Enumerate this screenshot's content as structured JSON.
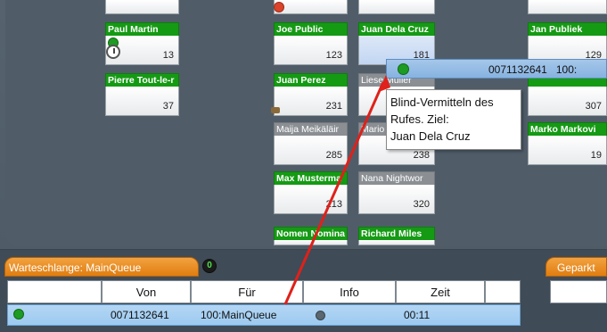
{
  "extensions": [
    {
      "name": "Paul Martin",
      "number": "13",
      "state": "green",
      "icon": "clock-icon"
    },
    {
      "name": "Pierre Tout-le-r",
      "number": "37",
      "state": "green"
    },
    {
      "name": "Joe Public",
      "number": "123",
      "state": "green"
    },
    {
      "name": "Juan Perez",
      "number": "231",
      "state": "green"
    },
    {
      "name": "Maija Meikäläir",
      "number": "285",
      "state": "gray"
    },
    {
      "name": "Max Musterma",
      "number": "213",
      "state": "green"
    },
    {
      "name": "Nomen Nomina",
      "number": "",
      "state": "green"
    },
    {
      "name": "Juan Dela Cruz",
      "number": "181",
      "state": "green"
    },
    {
      "name": "Liese Müller",
      "number": "",
      "state": "gray"
    },
    {
      "name": "Mario",
      "number": "238",
      "state": "gray"
    },
    {
      "name": "Nana Nightwor",
      "number": "320",
      "state": "gray"
    },
    {
      "name": "Richard Miles",
      "number": "",
      "state": "green"
    },
    {
      "name": "Jan Publiek",
      "number": "129",
      "state": "green"
    },
    {
      "name": "",
      "number": "307",
      "state": "green"
    },
    {
      "name": "Marko Markovi",
      "number": "19",
      "state": "green"
    }
  ],
  "drag": {
    "number": "0071132641",
    "target_short": "100:",
    "tooltip_line1": "Blind-Vermitteln des",
    "tooltip_line2": "Rufes. Ziel:",
    "tooltip_line3": "Juan Dela Cruz"
  },
  "queue": {
    "tab_label": "Warteschlange: MainQueue",
    "count": "0",
    "parked_label": "Geparkt",
    "columns": [
      "",
      "Von",
      "Für",
      "Info",
      "Zeit",
      ""
    ],
    "row": {
      "von": "0071132641",
      "fuer": "100:MainQueue",
      "zeit": "00:11"
    }
  },
  "colors": {
    "green": "#159a14",
    "orange": "#e07d10",
    "selected_row": "#9ccaf0",
    "arrow": "#e0201a"
  }
}
